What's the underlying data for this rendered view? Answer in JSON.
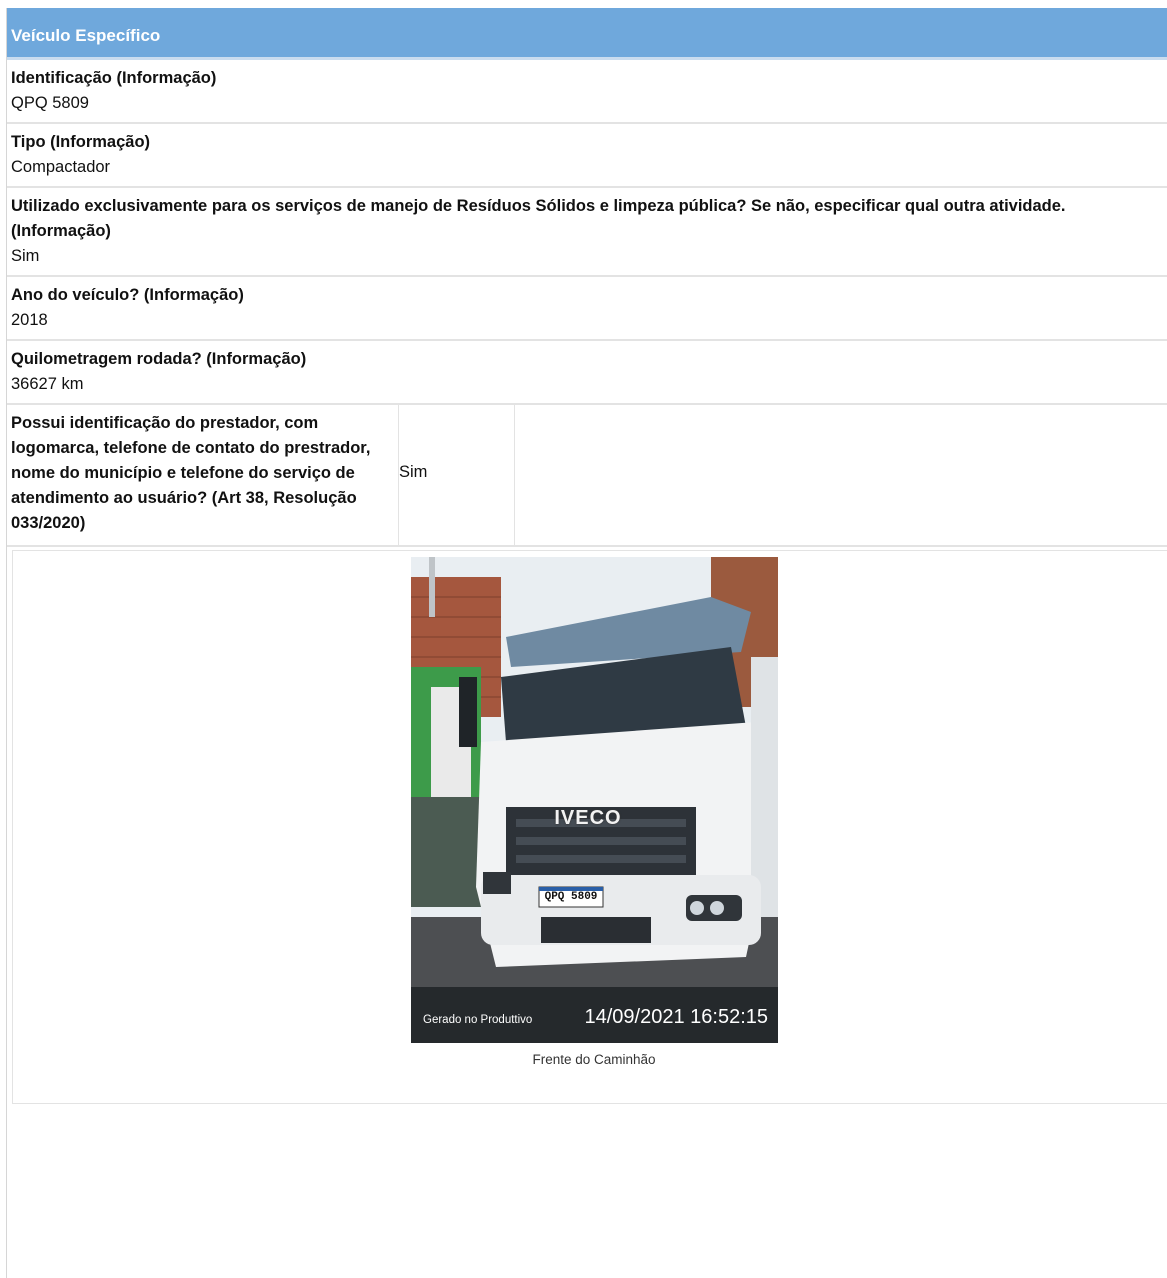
{
  "section": {
    "title": "Veículo Específico"
  },
  "fields": [
    {
      "label": "Identificação (Informação)",
      "value": "QPQ 5809"
    },
    {
      "label": "Tipo (Informação)",
      "value": "Compactador"
    },
    {
      "label": "Utilizado exclusivamente para os serviços de manejo de Resíduos Sólidos e limpeza pública? Se não, especificar qual outra atividade. (Informação)",
      "value": "Sim"
    },
    {
      "label": "Ano do veículo? (Informação)",
      "value": "2018"
    },
    {
      "label": "Quilometragem rodada? (Informação)",
      "value": "36627 km"
    }
  ],
  "split_field": {
    "label": "Possui identificação do prestador, com logomarca, telefone de contato do prestrador, nome do município e telefone do serviço de atendimento ao usuário? (Art 38, Resolução 033/2020)",
    "value": "Sim"
  },
  "photo": {
    "watermark_brand": "Gerado no Produttivo",
    "timestamp": "14/09/2021 16:52:15",
    "plate": "QPQ 5809",
    "grille_logo": "IVECO",
    "caption": "Frente do Caminhão"
  }
}
